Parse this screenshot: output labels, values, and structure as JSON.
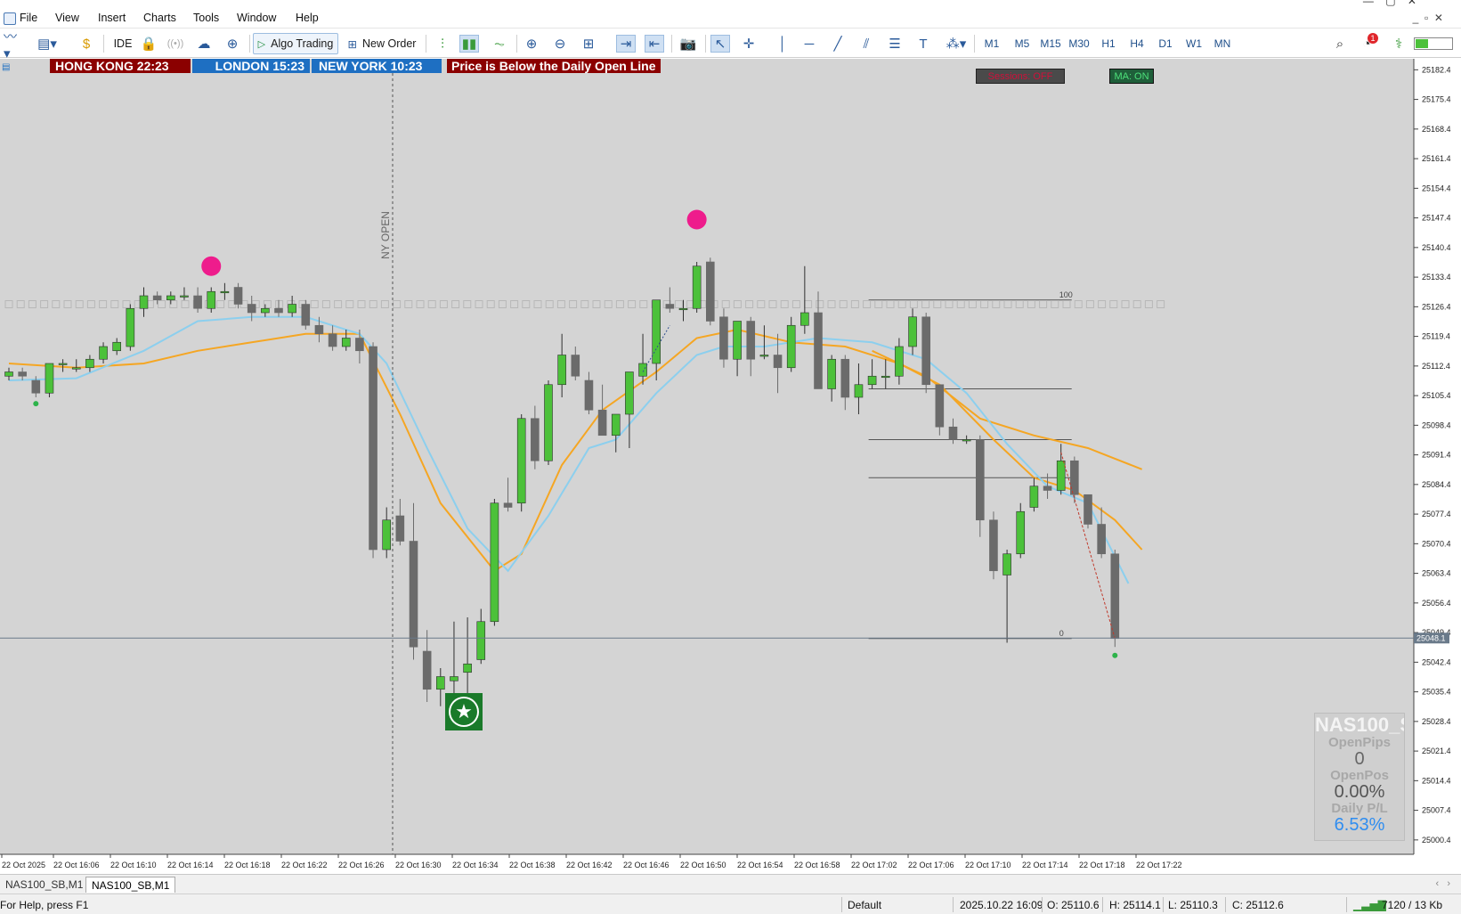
{
  "menu": {
    "items": [
      "File",
      "View",
      "Insert",
      "Charts",
      "Tools",
      "Window",
      "Help"
    ]
  },
  "toolbar": {
    "ide_label": "IDE",
    "algo_trading_label": "Algo Trading",
    "new_order_label": "New Order",
    "timeframes": [
      "M1",
      "M5",
      "M15",
      "M30",
      "H1",
      "H4",
      "D1",
      "W1",
      "MN"
    ],
    "active_timeframe": "M1",
    "notification_count": "1"
  },
  "session_banner": {
    "hong_kong": "HONG KONG 22:23",
    "london": "LONDON 15:23",
    "new_york": "NEW YORK 10:23",
    "message": "Price is Below the Daily Open Line"
  },
  "chart_buttons": {
    "sessions": "Sessions: OFF",
    "ma": "MA: ON"
  },
  "ny_open_label": "NY OPEN",
  "fib_labels": {
    "top": "100",
    "bottom": "0"
  },
  "info_panel": {
    "symbol": "NAS100_S",
    "open_pips_label": "OpenPips",
    "open_pips_value": "0",
    "open_pos_label": "OpenPos",
    "open_pos_value": "0.00%",
    "daily_pl_label": "Daily P/L",
    "daily_pl_value": "6.53%"
  },
  "colors": {
    "chart_bg": "#d4d4d4",
    "bull": "#4cc13a",
    "bear": "#6b6b6b",
    "fast_ma": "#8ccfee",
    "slow_ma": "#f5a623",
    "session_hk": "#8b0000",
    "session_lon": "#1e6fc2",
    "session_ny": "#1e6fc2",
    "message_bg": "#8b0000",
    "marker_pink": "#ee1c8c",
    "signal_green": "#1a7a2a"
  },
  "chart_data": {
    "type": "candlestick",
    "symbol": "NAS100_SB",
    "timeframe": "M1",
    "current_price": "25048.1",
    "y_ticks": [
      "25182.4",
      "25175.4",
      "25168.4",
      "25161.4",
      "25154.4",
      "25147.4",
      "25140.4",
      "25133.4",
      "25126.4",
      "25119.4",
      "25112.4",
      "25105.4",
      "25098.4",
      "25091.4",
      "25084.4",
      "25077.4",
      "25070.4",
      "25063.4",
      "25056.4",
      "25049.4",
      "25042.4",
      "25035.4",
      "25028.4",
      "25021.4",
      "25014.4",
      "25007.4",
      "25000.4"
    ],
    "x_ticks": [
      "22 Oct 2025",
      "22 Oct 16:06",
      "22 Oct 16:10",
      "22 Oct 16:14",
      "22 Oct 16:18",
      "22 Oct 16:22",
      "22 Oct 16:26",
      "22 Oct 16:30",
      "22 Oct 16:34",
      "22 Oct 16:38",
      "22 Oct 16:42",
      "22 Oct 16:46",
      "22 Oct 16:50",
      "22 Oct 16:54",
      "22 Oct 16:58",
      "22 Oct 17:02",
      "22 Oct 17:06",
      "22 Oct 17:10",
      "22 Oct 17:14",
      "22 Oct 17:18",
      "22 Oct 17:22"
    ],
    "ylim": [
      24997,
      25185
    ],
    "daily_open": 25127,
    "candles": [
      [
        25110,
        25112,
        25109,
        25111
      ],
      [
        25111,
        25112,
        25109,
        25110
      ],
      [
        25109,
        25110,
        25105,
        25106
      ],
      [
        25106,
        25113,
        25105,
        25113
      ],
      [
        25113,
        25114,
        25111,
        25113
      ],
      [
        25112,
        25114,
        25111,
        25112
      ],
      [
        25112,
        25115,
        25111,
        25114
      ],
      [
        25114,
        25118,
        25113,
        25117
      ],
      [
        25116,
        25119,
        25115,
        25118
      ],
      [
        25117,
        25127,
        25116,
        25126
      ],
      [
        25126,
        25131,
        25124,
        25129
      ],
      [
        25129,
        25130,
        25127,
        25128
      ],
      [
        25128,
        25130,
        25127,
        25129
      ],
      [
        25129,
        25131,
        25128,
        25129
      ],
      [
        25129,
        25131,
        25125,
        25126
      ],
      [
        25126,
        25131,
        25125,
        25130
      ],
      [
        25130,
        25132,
        25128,
        25130
      ],
      [
        25131,
        25132,
        25126,
        25127
      ],
      [
        25127,
        25129,
        25123,
        25125
      ],
      [
        25125,
        25127,
        25124,
        25126
      ],
      [
        25126,
        25128,
        25124,
        25125
      ],
      [
        25125,
        25129,
        25124,
        25127
      ],
      [
        25127,
        25128,
        25121,
        25122
      ],
      [
        25122,
        25124,
        25118,
        25120
      ],
      [
        25120,
        25122,
        25116,
        25117
      ],
      [
        25117,
        25121,
        25116,
        25119
      ],
      [
        25119,
        25121,
        25113,
        25116
      ],
      [
        25117,
        25118,
        25067,
        25069
      ],
      [
        25069,
        25079,
        25067,
        25076
      ],
      [
        25077,
        25081,
        25070,
        25071
      ],
      [
        25071,
        25080,
        25043,
        25046
      ],
      [
        25045,
        25050,
        25033,
        25036
      ],
      [
        25036,
        25041,
        25032,
        25039
      ],
      [
        25038,
        25052,
        25035,
        25039
      ],
      [
        25040,
        25053,
        25030,
        25042
      ],
      [
        25043,
        25055,
        25042,
        25052
      ],
      [
        25052,
        25081,
        25051,
        25080
      ],
      [
        25080,
        25086,
        25078,
        25079
      ],
      [
        25080,
        25101,
        25078,
        25100
      ],
      [
        25100,
        25103,
        25088,
        25090
      ],
      [
        25090,
        25109,
        25089,
        25108
      ],
      [
        25108,
        25120,
        25105,
        25115
      ],
      [
        25115,
        25117,
        25109,
        25110
      ],
      [
        25109,
        25111,
        25101,
        25102
      ],
      [
        25102,
        25108,
        25096,
        25096
      ],
      [
        25096,
        25101,
        25092,
        25101
      ],
      [
        25101,
        25111,
        25093,
        25111
      ],
      [
        25110,
        25120,
        25108,
        25113
      ],
      [
        25113,
        25128,
        25109,
        25128
      ],
      [
        25127,
        25131,
        25125,
        25126
      ],
      [
        25126,
        25128,
        25123,
        25126
      ],
      [
        25126,
        25137,
        25125,
        25136
      ],
      [
        25137,
        25138,
        25122,
        25123
      ],
      [
        25124,
        25126,
        25112,
        25114
      ],
      [
        25114,
        25123,
        25110,
        25123
      ],
      [
        25123,
        25124,
        25110,
        25114
      ],
      [
        25115,
        25122,
        25114,
        25115
      ],
      [
        25115,
        25120,
        25106,
        25112
      ],
      [
        25112,
        25124,
        25111,
        25122
      ],
      [
        25122,
        25136,
        25120,
        25125
      ],
      [
        25125,
        25130,
        25107,
        25107
      ],
      [
        25107,
        25115,
        25104,
        25114
      ],
      [
        25114,
        25115,
        25102,
        25105
      ],
      [
        25105,
        25113,
        25101,
        25108
      ],
      [
        25108,
        25114,
        25107,
        25110
      ],
      [
        25110,
        25114,
        25107,
        25110
      ],
      [
        25110,
        25119,
        25108,
        25117
      ],
      [
        25117,
        25126,
        25115,
        25124
      ],
      [
        25124,
        25125,
        25106,
        25108
      ],
      [
        25108,
        25108,
        25096,
        25098
      ],
      [
        25098,
        25100,
        25094,
        25095
      ],
      [
        25095,
        25096,
        25094,
        25095
      ],
      [
        25095,
        25096,
        25072,
        25076
      ],
      [
        25076,
        25078,
        25062,
        25064
      ],
      [
        25063,
        25069,
        25047,
        25068
      ],
      [
        25068,
        25080,
        25067,
        25078
      ],
      [
        25079,
        25086,
        25078,
        25084
      ],
      [
        25084,
        25087,
        25081,
        25083
      ],
      [
        25083,
        25094,
        25082,
        25090
      ],
      [
        25090,
        25091,
        25080,
        25082
      ],
      [
        25082,
        25082,
        25074,
        25075
      ],
      [
        25075,
        25079,
        25067,
        25068
      ],
      [
        25068,
        25069,
        25046,
        25048
      ]
    ],
    "fast_ma": [
      [
        0,
        25109
      ],
      [
        5,
        25109.5
      ],
      [
        10,
        25116
      ],
      [
        14,
        25123
      ],
      [
        18,
        25124
      ],
      [
        22,
        25124
      ],
      [
        26,
        25120
      ],
      [
        28,
        25113
      ],
      [
        31,
        25093
      ],
      [
        34,
        25074
      ],
      [
        37,
        25064
      ],
      [
        40,
        25077
      ],
      [
        43,
        25093
      ],
      [
        45,
        25095
      ],
      [
        48,
        25106
      ],
      [
        51,
        25115
      ],
      [
        53,
        25117
      ],
      [
        56,
        25117
      ],
      [
        60,
        25119
      ],
      [
        64,
        25118
      ],
      [
        68,
        25114
      ],
      [
        71,
        25106
      ],
      [
        74,
        25094
      ],
      [
        77,
        25084
      ],
      [
        80,
        25080
      ],
      [
        83,
        25061
      ]
    ],
    "slow_ma": [
      [
        0,
        25113
      ],
      [
        5,
        25112
      ],
      [
        10,
        25113
      ],
      [
        14,
        25116
      ],
      [
        18,
        25118
      ],
      [
        22,
        25120
      ],
      [
        26,
        25120
      ],
      [
        29,
        25101
      ],
      [
        32,
        25080
      ],
      [
        36,
        25064
      ],
      [
        38,
        25068
      ],
      [
        41,
        25089
      ],
      [
        44,
        25102
      ],
      [
        48,
        25111
      ],
      [
        51,
        25119
      ],
      [
        54,
        25121
      ],
      [
        58,
        25118
      ],
      [
        62,
        25117
      ],
      [
        66,
        25113
      ],
      [
        69,
        25108
      ],
      [
        73,
        25095
      ],
      [
        76,
        25086
      ],
      [
        79,
        25083
      ],
      [
        82,
        25076
      ],
      [
        84,
        25069
      ]
    ],
    "slow_ma2": [
      [
        64,
        25116
      ],
      [
        68,
        25110
      ],
      [
        72,
        25100
      ],
      [
        76,
        25096
      ],
      [
        80,
        25093
      ],
      [
        84,
        25088
      ]
    ]
  },
  "tabs": [
    "NAS100_SB,M1",
    "NAS100_SB,M1"
  ],
  "active_tab": 1,
  "status": {
    "help": "For Help, press F1",
    "profile": "Default",
    "datetime": "2025.10.22 16:09",
    "open": "O: 25110.6",
    "high": "H: 25114.1",
    "low": "L: 25110.3",
    "close": "C: 25112.6",
    "traffic": "7120 / 13 Kb"
  }
}
